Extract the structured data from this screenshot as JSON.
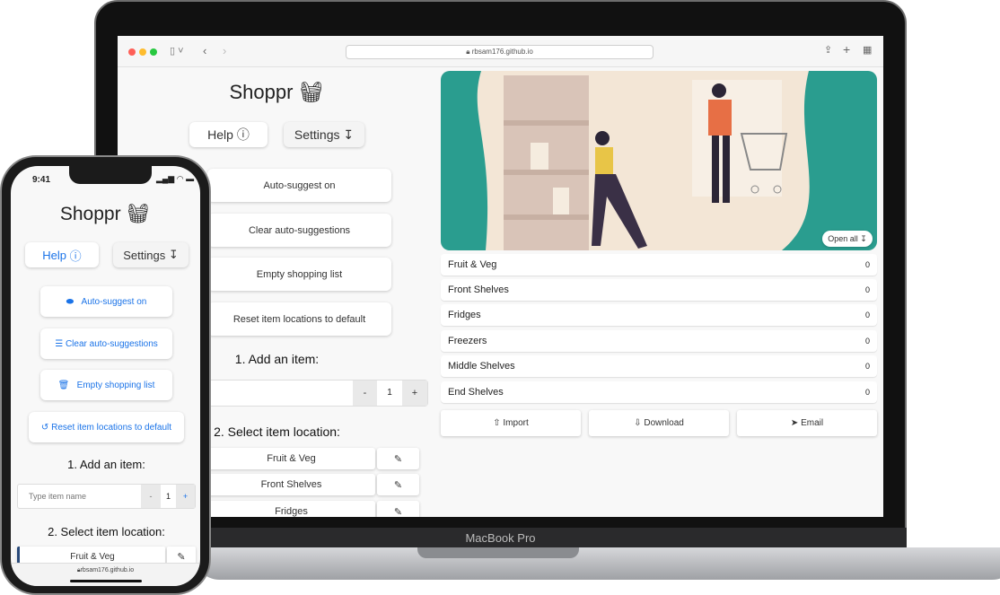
{
  "laptop": {
    "url": "rbsam176.github.io",
    "brand": "MacBook Pro",
    "title": "Shoppr",
    "help": "Help",
    "settings": "Settings",
    "actions": [
      "Auto-suggest on",
      "Clear auto-suggestions",
      "Empty shopping list",
      "Reset item locations to default"
    ],
    "add_heading": "1. Add an item:",
    "qty": "1",
    "minus": "-",
    "plus": "+",
    "select_heading": "2. Select item location:",
    "locations": [
      "Fruit & Veg",
      "Front Shelves",
      "Fridges"
    ],
    "open_all": "Open all",
    "sections": [
      {
        "name": "Fruit & Veg",
        "count": "0"
      },
      {
        "name": "Front Shelves",
        "count": "0"
      },
      {
        "name": "Fridges",
        "count": "0"
      },
      {
        "name": "Freezers",
        "count": "0"
      },
      {
        "name": "Middle Shelves",
        "count": "0"
      },
      {
        "name": "End Shelves",
        "count": "0"
      }
    ],
    "import": "Import",
    "download": "Download",
    "email": "Email"
  },
  "phone": {
    "time": "9:41",
    "title": "Shoppr",
    "help": "Help",
    "settings": "Settings",
    "actions": [
      "Auto-suggest on",
      "Clear auto-suggestions",
      "Empty shopping list",
      "Reset item locations to default"
    ],
    "add_heading": "1. Add an item:",
    "placeholder": "Type item name",
    "qty": "1",
    "minus": "-",
    "plus": "+",
    "select_heading": "2. Select item location:",
    "location": "Fruit & Veg",
    "url": "rbsam176.github.io"
  },
  "colors": {
    "accent": "#1a73e8",
    "teal": "#2a9d8f"
  }
}
